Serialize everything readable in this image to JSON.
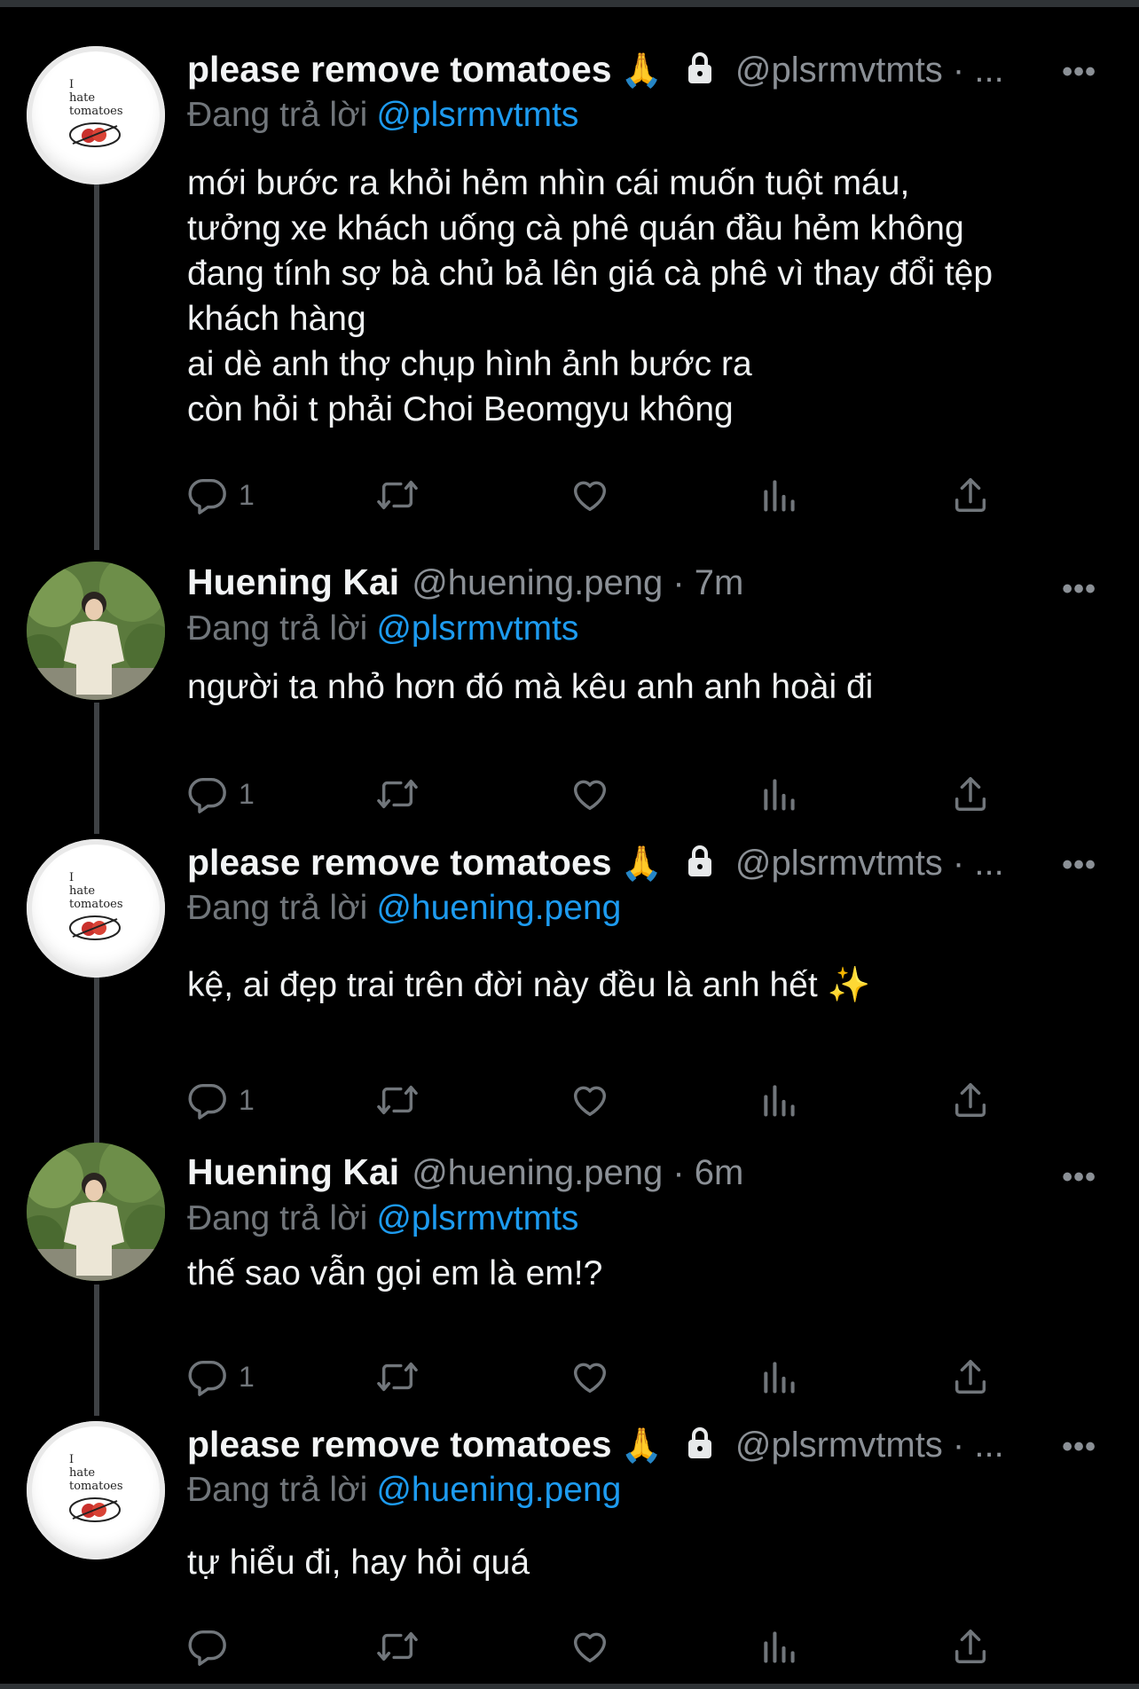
{
  "tweets": [
    {
      "author": "please remove tomatoes",
      "emoji": "🙏",
      "handle": "@plsrmvtmts · ...",
      "replying_label": "Đang trả lời",
      "replying_to": "@plsrmvtmts",
      "text": "mới bước ra khỏi hẻm nhìn cái muốn tuột máu,\ntưởng xe khách uống cà phê quán đầu hẻm không\nđang tính sợ bà chủ bả lên giá cà phê vì thay đổi tệp\nkhách hàng\nai dè anh thợ chụp hình ảnh bước ra\ncòn hỏi t phải Choi Beomgyu không",
      "reply_count": "1",
      "more": "•••",
      "avatar_text": [
        "I",
        "hate",
        "tomatoes"
      ]
    },
    {
      "author": "Huening Kai",
      "handle": "@huening.peng · 7m",
      "replying_label": "Đang trả lời",
      "replying_to": "@plsrmvtmts",
      "text": "người ta nhỏ hơn đó mà kêu anh anh hoài đi",
      "reply_count": "1",
      "more": "•••"
    },
    {
      "author": "please remove tomatoes",
      "emoji": "🙏",
      "handle": "@plsrmvtmts · ...",
      "replying_label": "Đang trả lời",
      "replying_to": "@huening.peng",
      "text": "kệ, ai đẹp trai trên đời này đều là anh hết ✨",
      "reply_count": "1",
      "more": "•••",
      "avatar_text": [
        "I",
        "hate",
        "tomatoes"
      ]
    },
    {
      "author": "Huening Kai",
      "handle": "@huening.peng · 6m",
      "replying_label": "Đang trả lời",
      "replying_to": "@plsrmvtmts",
      "text": "thế sao vẫn gọi em là em!?",
      "reply_count": "1",
      "more": "•••"
    },
    {
      "author": "please remove tomatoes",
      "emoji": "🙏",
      "handle": "@plsrmvtmts · ...",
      "replying_label": "Đang trả lời",
      "replying_to": "@huening.peng",
      "text": "tự hiểu đi, hay hỏi quá",
      "reply_count": "",
      "more": "•••",
      "avatar_text": [
        "I",
        "hate",
        "tomatoes"
      ]
    }
  ],
  "icons": {
    "reply": "reply-icon",
    "retweet": "retweet-icon",
    "like": "heart-icon",
    "views": "views-icon",
    "share": "share-icon",
    "lock": "lock-icon"
  },
  "colors": {
    "background": "#000000",
    "text": "#e7e9ea",
    "secondary": "#71767b",
    "mention": "#1d9bf0"
  }
}
